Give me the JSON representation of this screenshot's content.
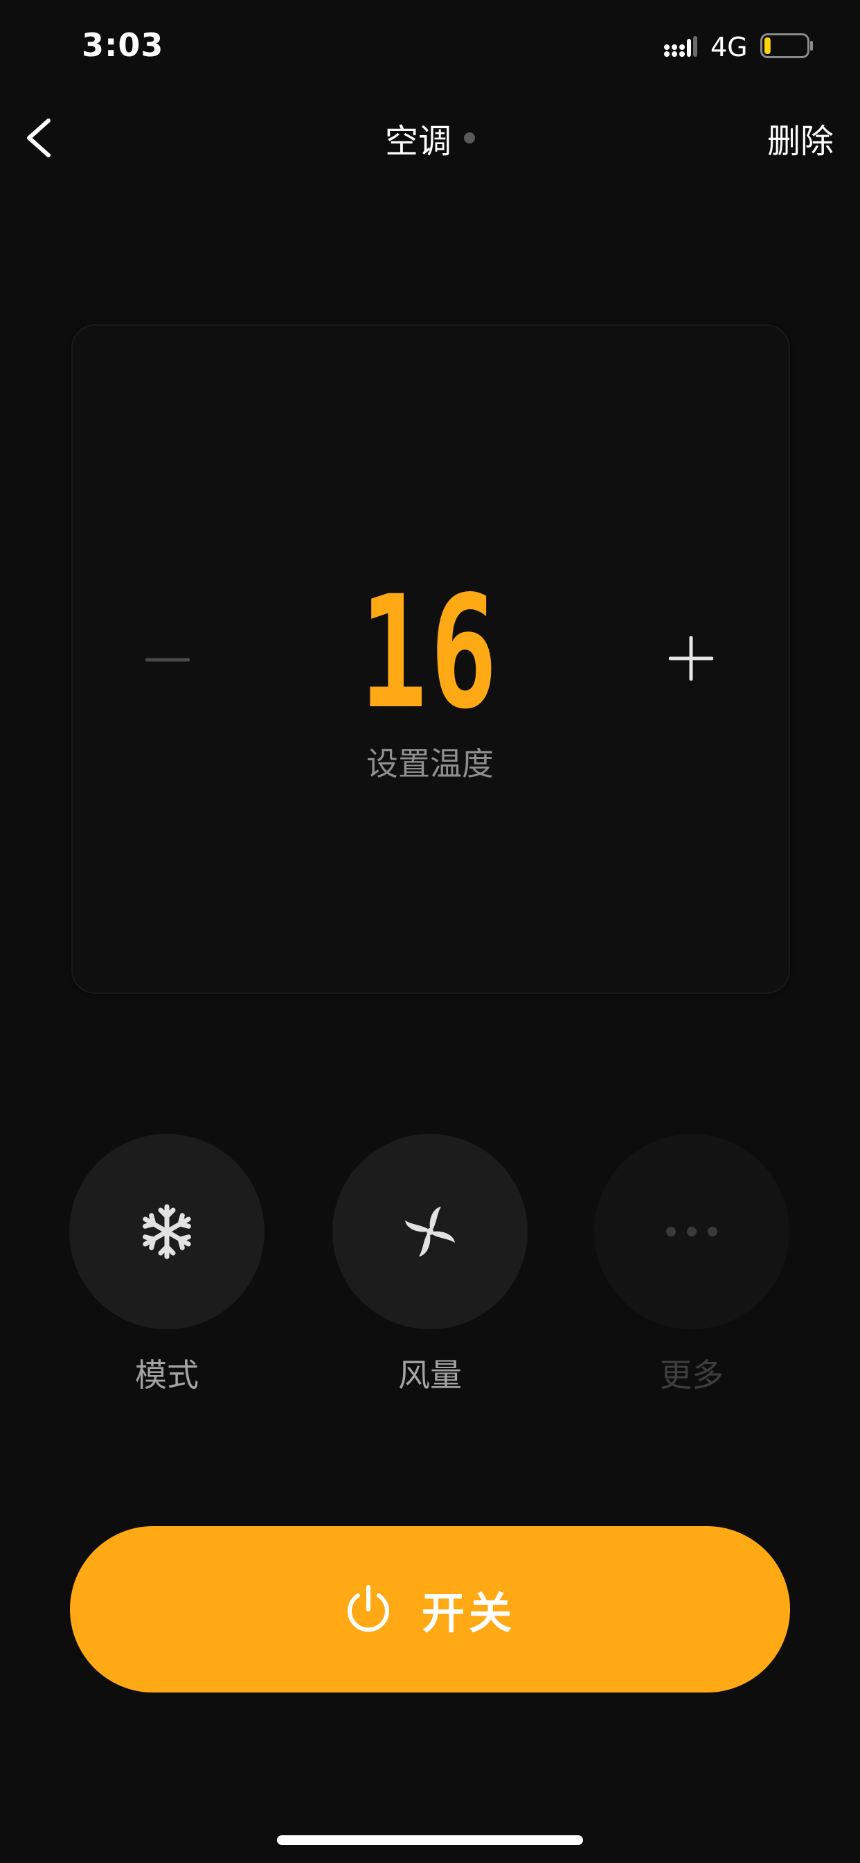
{
  "status_bar": {
    "time": "3:03",
    "network": "4G",
    "battery_level": 0.15,
    "battery_color": "#ffd60a"
  },
  "nav": {
    "title": "空调",
    "delete_label": "删除",
    "back_icon": "chevron-left-icon"
  },
  "temperature": {
    "value": "16",
    "label": "设置温度",
    "minus_icon": "minus-icon",
    "plus_icon": "plus-icon"
  },
  "functions": [
    {
      "label": "模式",
      "icon": "snowflake-icon",
      "enabled": true
    },
    {
      "label": "风量",
      "icon": "fan-icon",
      "enabled": true
    },
    {
      "label": "更多",
      "icon": "more-icon",
      "enabled": false
    }
  ],
  "power": {
    "label": "开关",
    "icon": "power-icon"
  },
  "colors": {
    "accent": "#ffa914",
    "background": "#0d0d0d"
  }
}
